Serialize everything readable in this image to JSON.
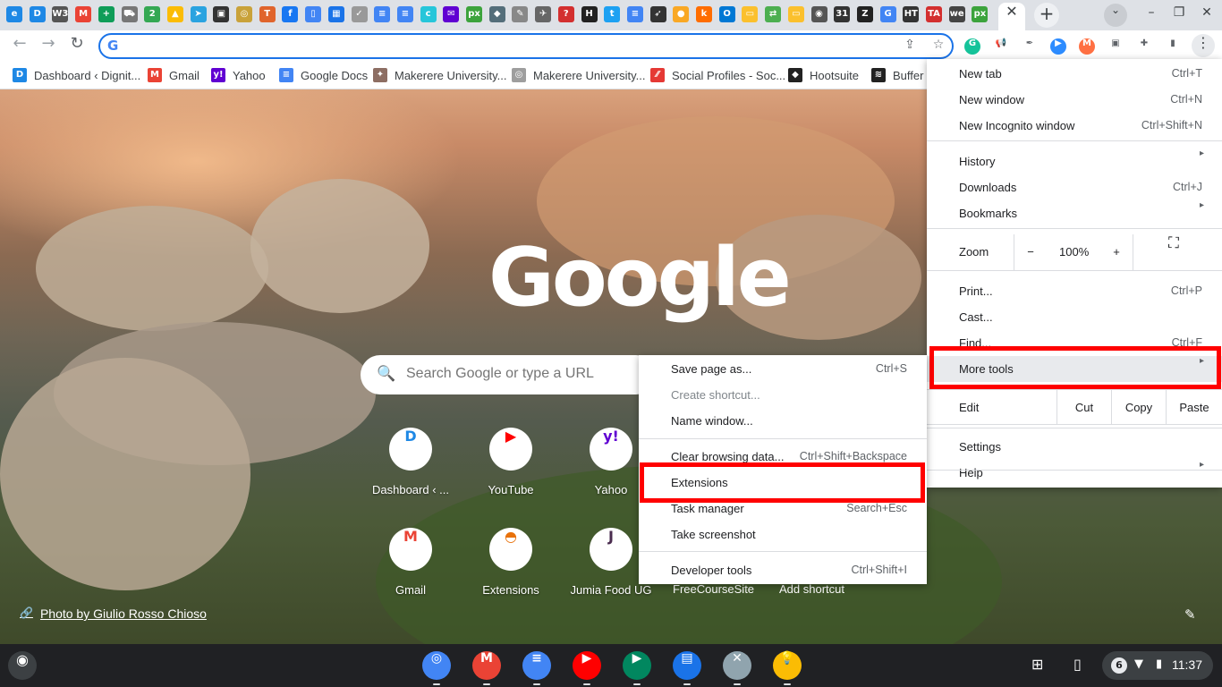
{
  "tabs": {
    "favicons": [
      {
        "name": "edge-icon",
        "text": "e",
        "color": "#1e88e5"
      },
      {
        "name": "dignited-icon",
        "text": "D",
        "color": "#1e88e5"
      },
      {
        "name": "w3-icon",
        "text": "W3",
        "color": "#555555"
      },
      {
        "name": "gmail-icon",
        "text": "M",
        "color": "#ea4335"
      },
      {
        "name": "sheets-icon",
        "text": "+",
        "color": "#0f9d58"
      },
      {
        "name": "cart-icon",
        "text": "⛟",
        "color": "#777777"
      },
      {
        "name": "two-icon",
        "text": "2",
        "color": "#34a853"
      },
      {
        "name": "drive-icon",
        "text": "▲",
        "color": "#fbbc05"
      },
      {
        "name": "telegram-icon",
        "text": "➤",
        "color": "#2aa3e0"
      },
      {
        "name": "news-icon",
        "text": "▣",
        "color": "#333333"
      },
      {
        "name": "coin-icon",
        "text": "◎",
        "color": "#c9a23a"
      },
      {
        "name": "t-icon",
        "text": "T",
        "color": "#e0642c"
      },
      {
        "name": "facebook-icon",
        "text": "f",
        "color": "#1877f2"
      },
      {
        "name": "docs-icon",
        "text": "▯",
        "color": "#4285f4"
      },
      {
        "name": "calendar-icon",
        "text": "▦",
        "color": "#1a73e8"
      },
      {
        "name": "twitter-icon",
        "text": "✓",
        "color": "#999999"
      },
      {
        "name": "docs2-icon",
        "text": "≡",
        "color": "#4285f4"
      },
      {
        "name": "docs3-icon",
        "text": "≡",
        "color": "#4285f4"
      },
      {
        "name": "c-icon",
        "text": "c",
        "color": "#26c6da"
      },
      {
        "name": "yahoo-mail-icon",
        "text": "✉",
        "color": "#6001d2"
      },
      {
        "name": "px-icon",
        "text": "px",
        "color": "#3ca33c"
      },
      {
        "name": "grad-icon",
        "text": "◆",
        "color": "#546e7a"
      },
      {
        "name": "feather-icon",
        "text": "✎",
        "color": "#888888"
      },
      {
        "name": "bird-icon",
        "text": "✈",
        "color": "#666666"
      },
      {
        "name": "question-icon",
        "text": "?",
        "color": "#d32f2f"
      },
      {
        "name": "h-icon",
        "text": "H",
        "color": "#222222"
      },
      {
        "name": "twitter2-icon",
        "text": "t",
        "color": "#1da1f2"
      },
      {
        "name": "docs4-icon",
        "text": "≡",
        "color": "#4285f4"
      },
      {
        "name": "arrow-icon",
        "text": "➶",
        "color": "#333333"
      },
      {
        "name": "bee-icon",
        "text": "●",
        "color": "#f9a825"
      },
      {
        "name": "k-icon",
        "text": "k",
        "color": "#ff6d00"
      },
      {
        "name": "outlook-icon",
        "text": "O",
        "color": "#0078d4"
      },
      {
        "name": "note-icon",
        "text": "▭",
        "color": "#fbc02d"
      },
      {
        "name": "translate-icon",
        "text": "⇄",
        "color": "#4caf50"
      },
      {
        "name": "keep-icon",
        "text": "▭",
        "color": "#fbc02d"
      },
      {
        "name": "globe-icon",
        "text": "◉",
        "color": "#555555"
      },
      {
        "name": "cal31-icon",
        "text": "31",
        "color": "#333333"
      },
      {
        "name": "z-icon",
        "text": "Z",
        "color": "#222222"
      },
      {
        "name": "google-icon",
        "text": "G",
        "color": "#4285f4"
      },
      {
        "name": "htg-icon",
        "text": "HT",
        "color": "#333333"
      },
      {
        "name": "ta-icon",
        "text": "TA",
        "color": "#d32f2f"
      },
      {
        "name": "we-icon",
        "text": "we",
        "color": "#444444"
      },
      {
        "name": "px2-icon",
        "text": "px",
        "color": "#3ca33c"
      }
    ],
    "active_close": "✕",
    "new_tab": "+",
    "search_tabs": "⌄",
    "minimize": "–",
    "restore": "❐",
    "close": "✕"
  },
  "toolbar": {
    "back": "←",
    "forward": "→",
    "reload": "↻",
    "omnibox_value": "",
    "share": "⇪",
    "star": "☆",
    "extensions": [
      {
        "name": "grammarly-icon",
        "text": "G",
        "color": "#15c39a"
      },
      {
        "name": "megaphone-icon",
        "text": "📢",
        "color": "#ffffff"
      },
      {
        "name": "eyedropper-icon",
        "text": "✒",
        "color": "#ffffff"
      },
      {
        "name": "zoom-ext-icon",
        "text": "▶",
        "color": "#2d8cff"
      },
      {
        "name": "mi-icon",
        "text": "M",
        "color": "#ff7043"
      },
      {
        "name": "cookie-icon",
        "text": "▣",
        "color": "#ffffff"
      },
      {
        "name": "puzzle-icon",
        "text": "✚",
        "color": "#ffffff"
      },
      {
        "name": "sidepanel-icon",
        "text": "▮",
        "color": "#ffffff"
      }
    ],
    "kebab": "⋮"
  },
  "bookmarks": [
    {
      "name": "bookmark-dashboard",
      "label": "Dashboard ‹ Dignit...",
      "icon": "D",
      "color": "#1e88e5"
    },
    {
      "name": "bookmark-gmail",
      "label": "Gmail",
      "icon": "M",
      "color": "#ea4335"
    },
    {
      "name": "bookmark-yahoo",
      "label": "Yahoo",
      "icon": "y!",
      "color": "#6001d2"
    },
    {
      "name": "bookmark-google-docs",
      "label": "Google Docs",
      "icon": "≡",
      "color": "#4285f4"
    },
    {
      "name": "bookmark-makerere-1",
      "label": "Makerere University...",
      "icon": "✦",
      "color": "#8d6e63"
    },
    {
      "name": "bookmark-makerere-2",
      "label": "Makerere University...",
      "icon": "◎",
      "color": "#9e9e9e"
    },
    {
      "name": "bookmark-social-profiles",
      "label": "Social Profiles - Soc...",
      "icon": "⁄⁄",
      "color": "#e53935"
    },
    {
      "name": "bookmark-hootsuite",
      "label": "Hootsuite",
      "icon": "◆",
      "color": "#222222"
    },
    {
      "name": "bookmark-buffer",
      "label": "Buffer P",
      "icon": "≋",
      "color": "#222222"
    }
  ],
  "ntp": {
    "logo": "Google",
    "search_placeholder": "Search Google or type a URL",
    "search_icon": "🔍",
    "shortcuts": [
      {
        "name": "shortcut-dashboard",
        "label": "Dashboard ‹ ...",
        "icon": "D",
        "color": "#1e88e5"
      },
      {
        "name": "shortcut-youtube",
        "label": "YouTube",
        "icon": "▶",
        "color": "#ff0000"
      },
      {
        "name": "shortcut-yahoo",
        "label": "Yahoo",
        "icon": "y!",
        "color": "#6001d2"
      },
      {
        "name": "shortcut-gmail",
        "label": "Gmail",
        "icon": "M",
        "color": "#ea4335"
      },
      {
        "name": "shortcut-extensions",
        "label": "Extensions",
        "icon": "◓",
        "color": "#e8710a"
      },
      {
        "name": "shortcut-jumia",
        "label": "Jumia Food UG",
        "icon": "J",
        "color": "#4a2c4f"
      }
    ],
    "hidden_labels": [
      "FreeCourseSite",
      "Add shortcut"
    ],
    "photo_credit": "Photo by Giulio Rosso Chioso",
    "link_icon": "🔗",
    "edit_icon": "✎"
  },
  "main_menu": {
    "items": [
      {
        "label": "New tab",
        "shortcut": "Ctrl+T"
      },
      {
        "label": "New window",
        "shortcut": "Ctrl+N"
      },
      {
        "label": "New Incognito window",
        "shortcut": "Ctrl+Shift+N"
      },
      {
        "label": "History",
        "shortcut": "▸"
      },
      {
        "label": "Downloads",
        "shortcut": "Ctrl+J"
      },
      {
        "label": "Bookmarks",
        "shortcut": "▸"
      },
      {
        "label": "Print...",
        "shortcut": "Ctrl+P"
      },
      {
        "label": "Cast...",
        "shortcut": ""
      },
      {
        "label": "Find...",
        "shortcut": "Ctrl+F"
      },
      {
        "label": "More tools",
        "shortcut": "▸"
      },
      {
        "label": "Settings",
        "shortcut": ""
      },
      {
        "label": "Help",
        "shortcut": "▸"
      }
    ],
    "zoom": {
      "label": "Zoom",
      "minus": "−",
      "value": "100%",
      "plus": "+",
      "fullscreen": "⛶"
    },
    "edit": {
      "label": "Edit",
      "cut": "Cut",
      "copy": "Copy",
      "paste": "Paste"
    }
  },
  "sub_menu": {
    "items": [
      {
        "label": "Save page as...",
        "shortcut": "Ctrl+S",
        "disabled": false
      },
      {
        "label": "Create shortcut...",
        "shortcut": "",
        "disabled": true
      },
      {
        "label": "Name window...",
        "shortcut": "",
        "disabled": false
      },
      {
        "label": "Clear browsing data...",
        "shortcut": "Ctrl+Shift+Backspace",
        "disabled": false
      },
      {
        "label": "Extensions",
        "shortcut": "",
        "disabled": false
      },
      {
        "label": "Task manager",
        "shortcut": "Search+Esc",
        "disabled": false
      },
      {
        "label": "Take screenshot",
        "shortcut": "",
        "disabled": false
      },
      {
        "label": "Developer tools",
        "shortcut": "Ctrl+Shift+I",
        "disabled": false
      }
    ]
  },
  "highlight_color": "#ff0000",
  "shelf": {
    "launcher": "◉",
    "apps": [
      {
        "name": "chrome-app-icon",
        "text": "◎",
        "color": "#4285f4"
      },
      {
        "name": "gmail-app-icon",
        "text": "M",
        "color": "#ea4335"
      },
      {
        "name": "docs-app-icon",
        "text": "≡",
        "color": "#4285f4"
      },
      {
        "name": "youtube-app-icon",
        "text": "▶",
        "color": "#ff0000"
      },
      {
        "name": "play-store-app-icon",
        "text": "▶",
        "color": "#01875f"
      },
      {
        "name": "messages-app-icon",
        "text": "▤",
        "color": "#1a73e8"
      },
      {
        "name": "tools-app-icon",
        "text": "✕",
        "color": "#90a4ae"
      },
      {
        "name": "keep-app-icon",
        "text": "💡",
        "color": "#fbbc04"
      }
    ],
    "tray": {
      "screenshot": "⊞",
      "phone": "▯",
      "notifications": "6",
      "wifi": "▼",
      "battery": "▮",
      "time": "11:37"
    }
  }
}
